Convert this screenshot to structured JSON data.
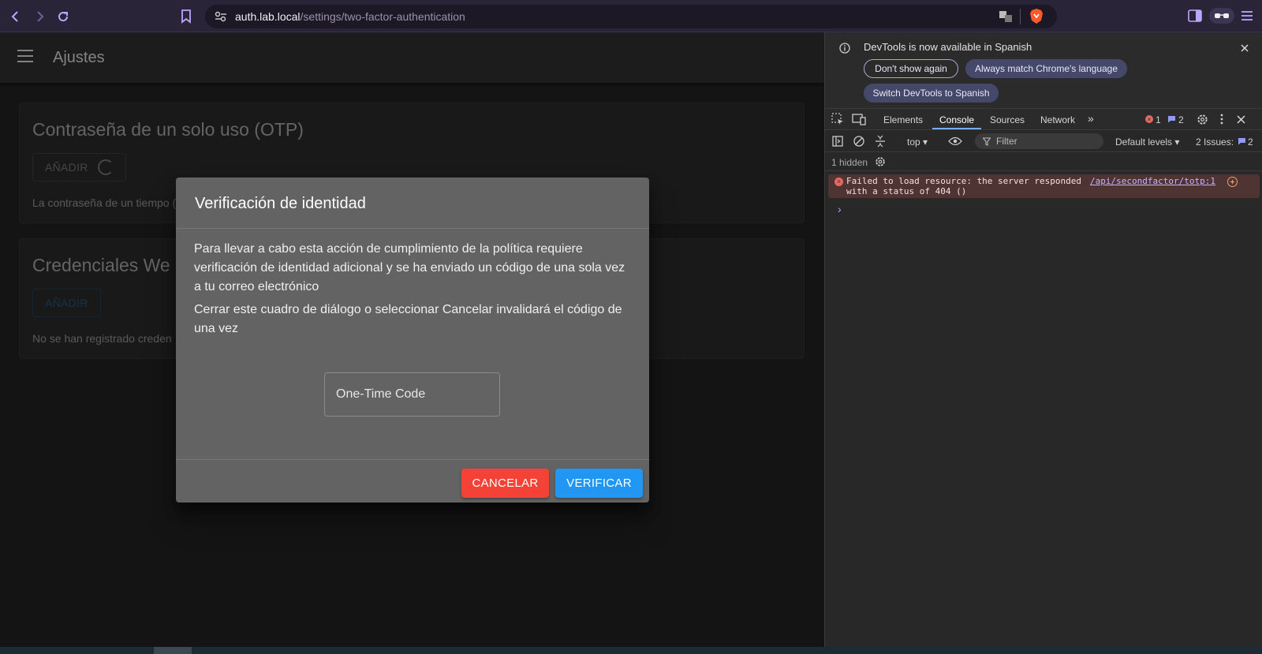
{
  "browser": {
    "url_host": "auth.lab.local",
    "url_path": "/settings/two-factor-authentication"
  },
  "app": {
    "title": "Ajustes",
    "otp_card": {
      "title": "Contraseña de un solo uso (OTP)",
      "add_label": "AÑADIR",
      "text": "La contraseña de un tiempo ("
    },
    "webauthn_card": {
      "title": "Credenciales We",
      "add_label": "AÑADIR",
      "text": "No se han registrado creden"
    }
  },
  "dialog": {
    "title": "Verificación de identidad",
    "paragraph1": "Para llevar a cabo esta acción de cumplimiento de la política requiere verificación de identidad adicional y se ha enviado un código de una sola vez a tu correo electrónico",
    "paragraph2": "Cerrar este cuadro de diálogo o seleccionar Cancelar invalidará el código de una vez",
    "otp_placeholder": "One-Time Code",
    "cancel_label": "CANCELAR",
    "verify_label": "VERIFICAR"
  },
  "devtools": {
    "banner_text": "DevTools is now available in Spanish",
    "dont_show_label": "Don't show again",
    "always_match_label": "Always match Chrome's language",
    "switch_label": "Switch DevTools to Spanish",
    "tabs": [
      "Elements",
      "Console",
      "Sources",
      "Network"
    ],
    "active_tab": "Console",
    "error_count": "1",
    "message_count": "2",
    "context": "top",
    "filter_placeholder": "Filter",
    "levels": "Default levels",
    "issues_label": "2 Issues:",
    "issues_count": "2",
    "hidden_label": "1 hidden",
    "error_message": "Failed to load resource: the server responded with a status of 404 ()",
    "error_source": "/api/secondfactor/totp:1",
    "prompt": "›"
  },
  "colors": {
    "cancel": "#f44336",
    "verify": "#2196f3",
    "dialog_bg": "#636363"
  }
}
